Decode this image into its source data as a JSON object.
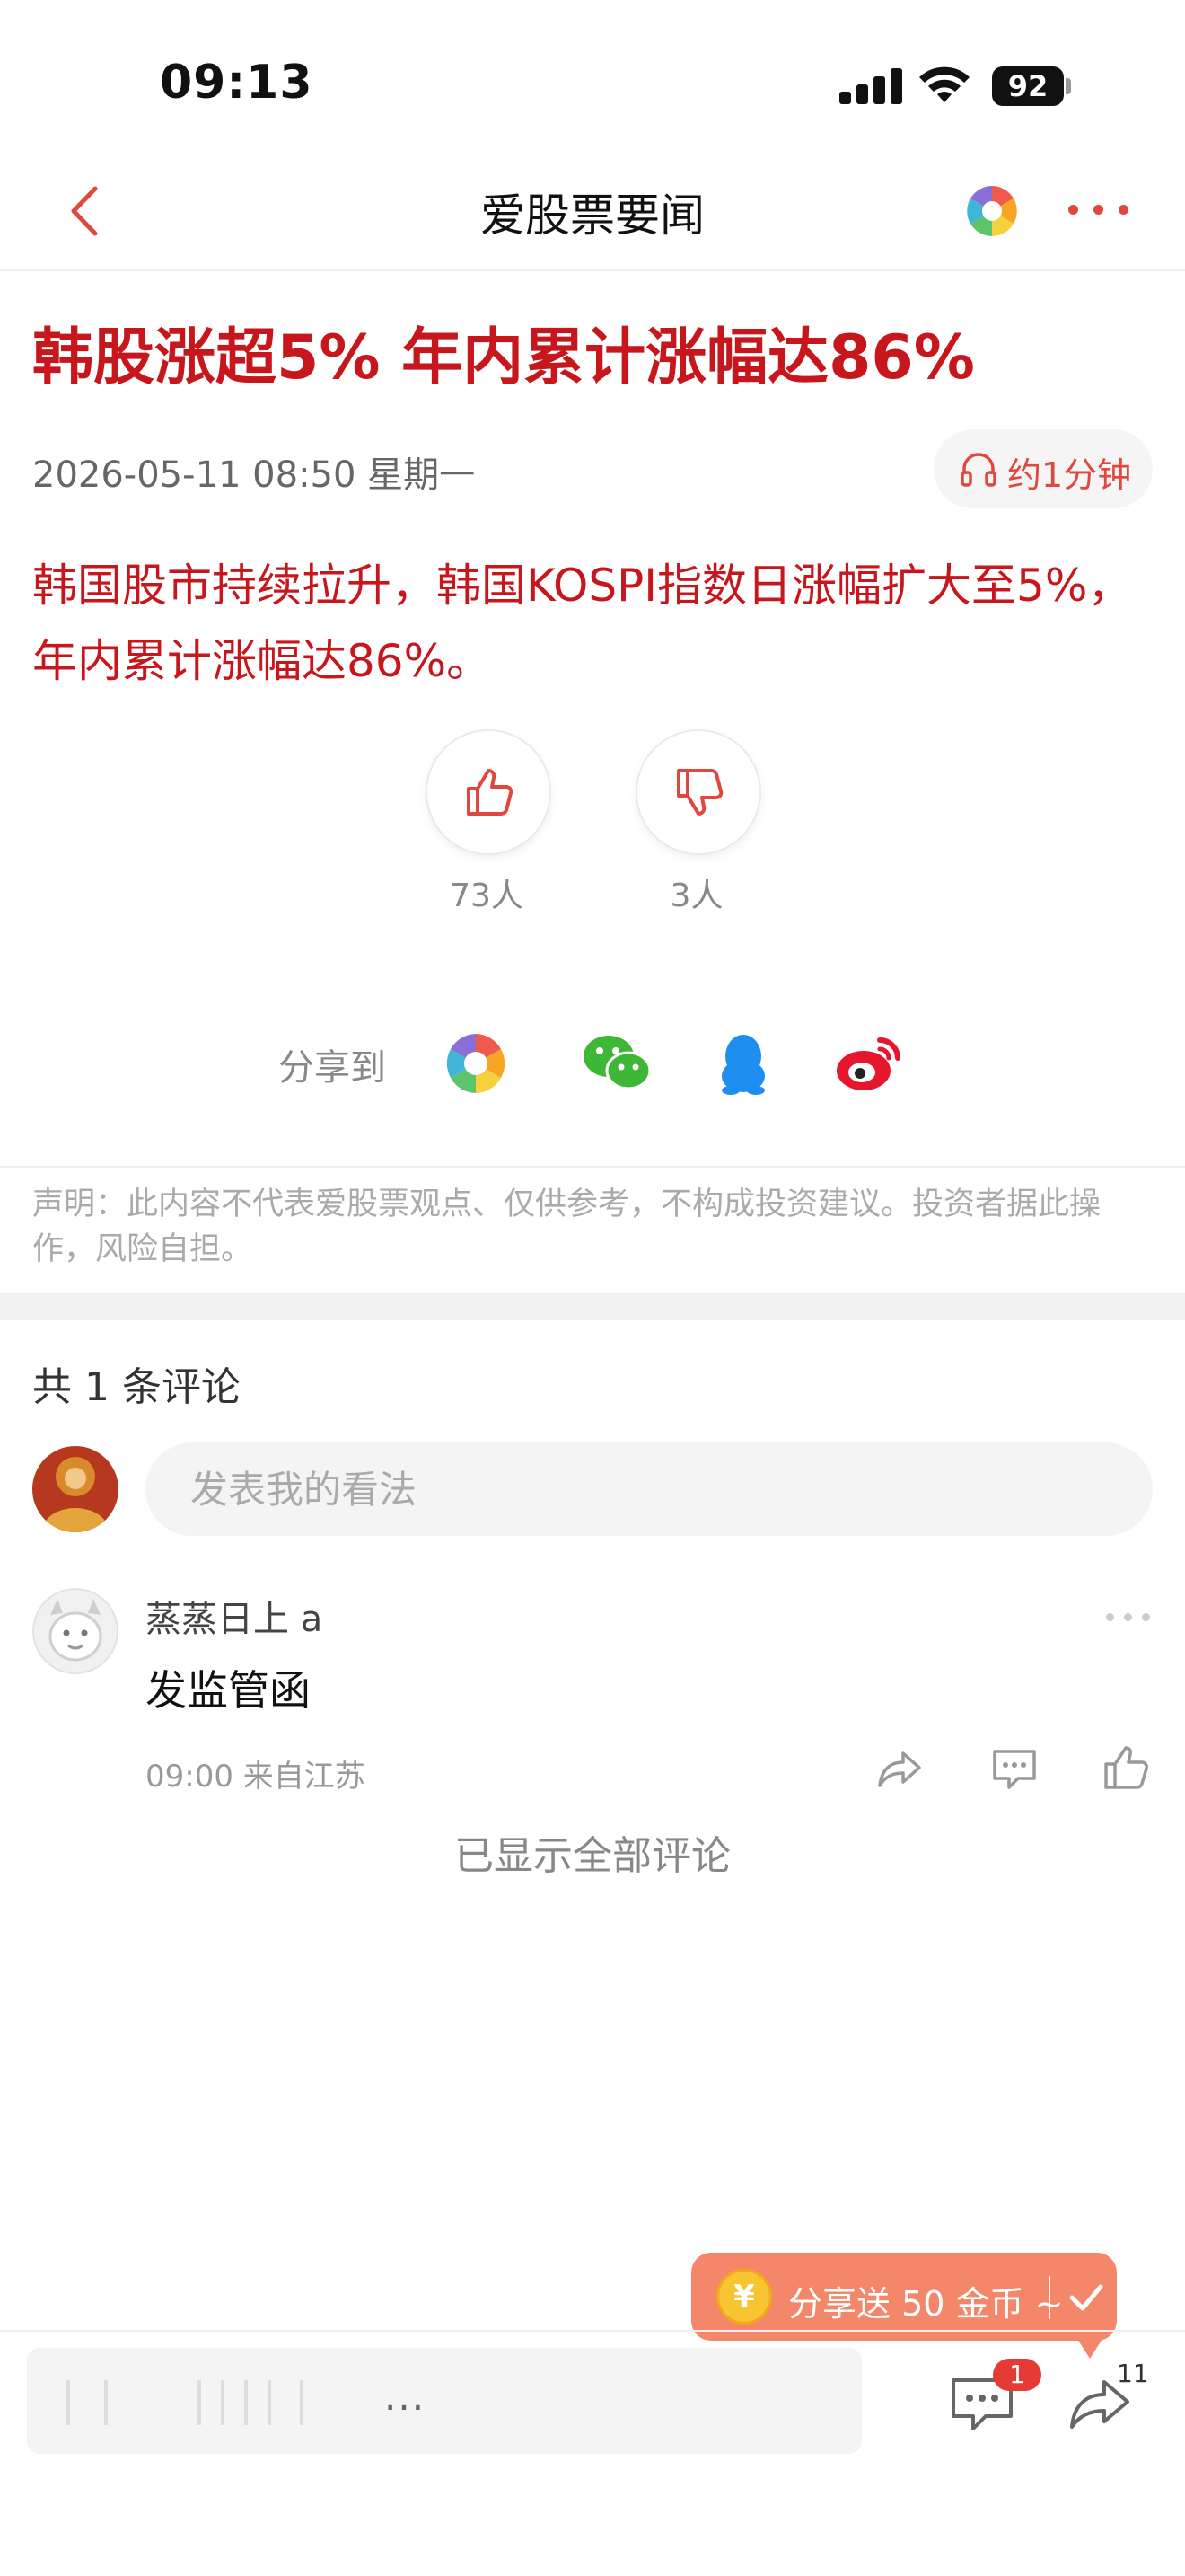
{
  "status_bar": {
    "time": "09:13",
    "battery": "92"
  },
  "nav": {
    "title": "爱股票要闻",
    "back_icon": "chevron-left-icon",
    "more_icon": "more-dots-icon"
  },
  "article": {
    "headline": "韩股涨超5% 年内累计涨幅达86%",
    "date": "2026-05-11 08:50  星期一",
    "listen_label": "约1分钟",
    "body": "韩国股市持续拉升，韩国KOSPI指数日涨幅扩大至5%，年内累计涨幅达86%。",
    "likes": "73人",
    "dislikes": "3人"
  },
  "share": {
    "label": "分享到",
    "targets": [
      "app-logo",
      "wechat",
      "qq",
      "weibo"
    ]
  },
  "disclaimer": "声明：此内容不代表爱股票观点、仅供参考，不构成投资建议。投资者据此操作，风险自担。",
  "comments": {
    "count_label": "共 1 条评论",
    "input_placeholder": "发表我的看法",
    "items": [
      {
        "user": "蒸蒸日上 a",
        "text": "发监管函",
        "meta": "09:00 来自江苏"
      }
    ],
    "all_shown": "已显示全部评论"
  },
  "promo": {
    "coin_symbol": "¥",
    "text": "分享送 50 金币 ~"
  },
  "bottom_bar": {
    "input_placeholder": "...",
    "comment_badge": "1",
    "share_count": "11"
  },
  "colors": {
    "accent": "#c8161d",
    "icon_red": "#e0483f",
    "promo": "#f4866a"
  }
}
